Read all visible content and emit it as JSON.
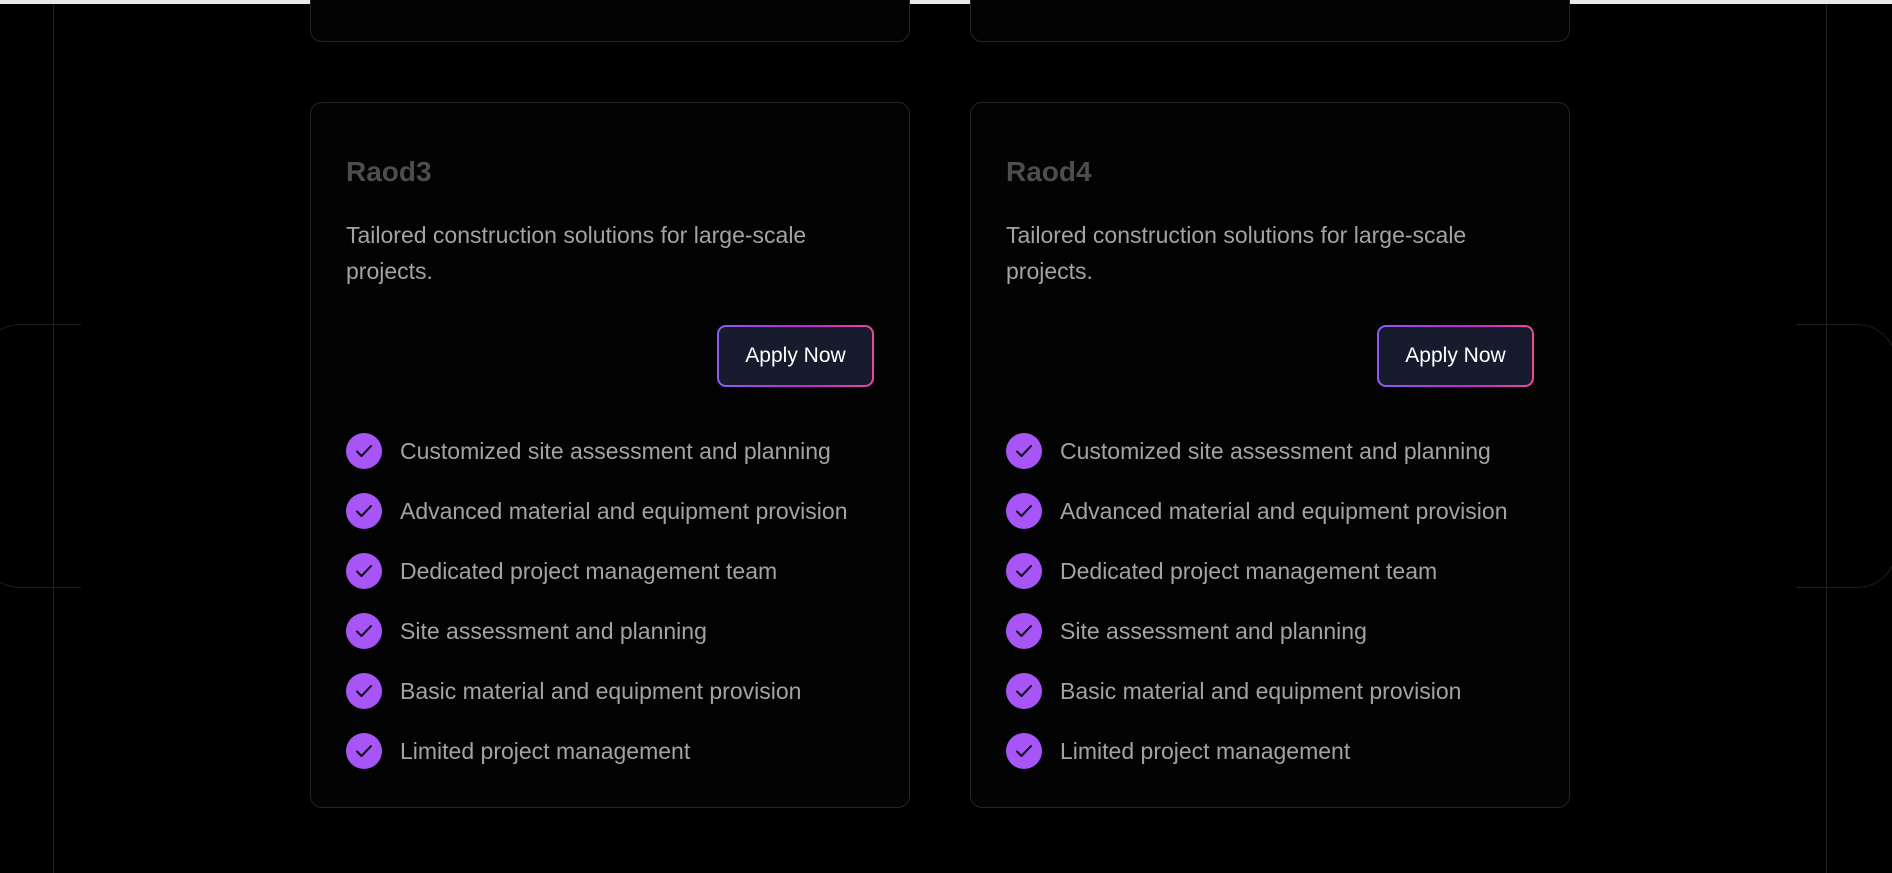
{
  "cards": [
    {
      "title": "Raod3",
      "description": "Tailored construction solutions for large-scale projects.",
      "button_label": "Apply Now",
      "features": [
        "Customized site assessment and planning",
        "Advanced material and equipment provision",
        "Dedicated project management team",
        "Site assessment and planning",
        "Basic material and equipment provision",
        "Limited project management"
      ]
    },
    {
      "title": "Raod4",
      "description": "Tailored construction solutions for large-scale projects.",
      "button_label": "Apply Now",
      "features": [
        "Customized site assessment and planning",
        "Advanced material and equipment provision",
        "Dedicated project management team",
        "Site assessment and planning",
        "Basic material and equipment provision",
        "Limited project management"
      ]
    }
  ],
  "icons": {
    "feature_check": "check-circle-icon"
  },
  "colors": {
    "background": "#000000",
    "card_border": "#262626",
    "title": "#4d4d4d",
    "text": "#a3a3a3",
    "check_fill": "#a855f7",
    "button_bg": "#161b2e",
    "button_gradient_start": "#8b5cf6",
    "button_gradient_end": "#ec4899"
  }
}
